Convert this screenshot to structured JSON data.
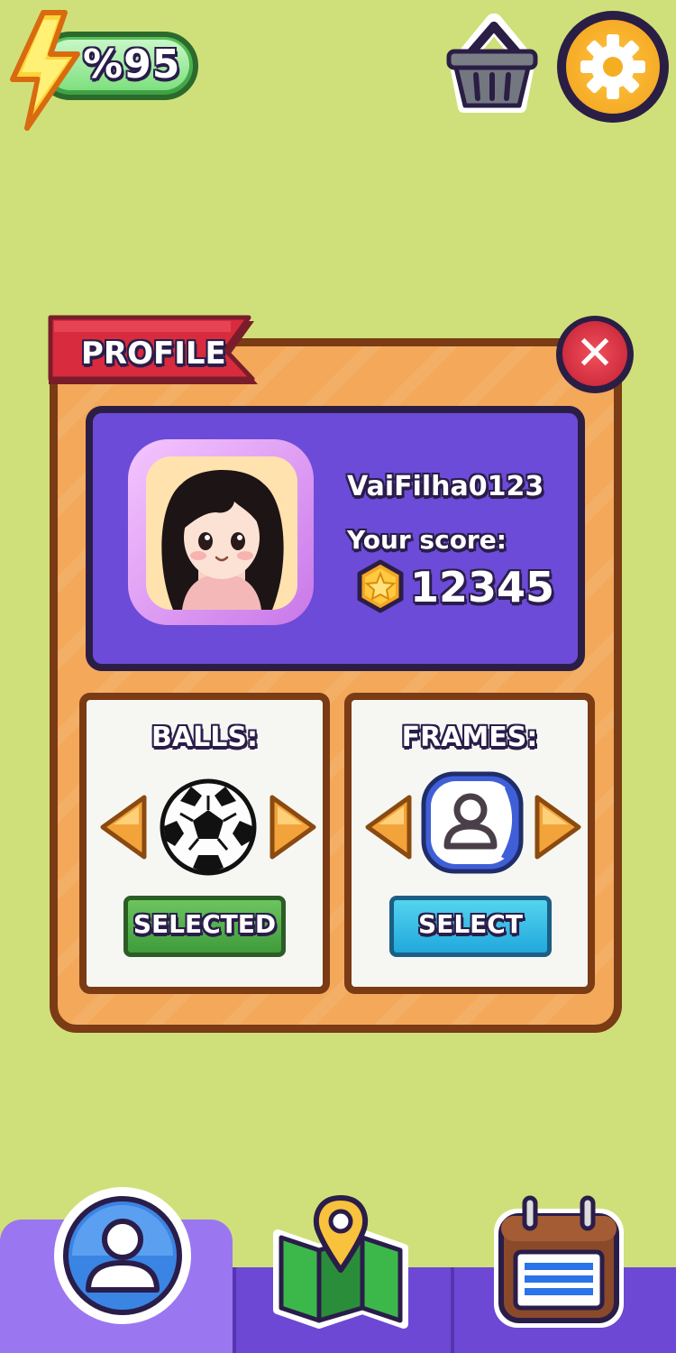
{
  "hud": {
    "energy": "%95",
    "energy_level": 0.95,
    "shop_icon": "basket-icon",
    "settings_icon": "gear-icon"
  },
  "profile": {
    "title": "PROFILE",
    "close_icon": "close-icon",
    "username": "VaiFilha0123",
    "score_label": "Your score:",
    "score": "12345",
    "coin_icon": "star-coin-icon"
  },
  "balls": {
    "title": "BALLS:",
    "item_icon": "soccer-ball-icon",
    "button_label": "SELECTED"
  },
  "frames": {
    "title": "FRAMES:",
    "item_icon": "user-frame-icon",
    "button_label": "SELECT"
  },
  "nav": {
    "items": [
      {
        "icon": "profile-icon",
        "active": true
      },
      {
        "icon": "map-icon",
        "active": false
      },
      {
        "icon": "calendar-icon",
        "active": false
      }
    ]
  },
  "colors": {
    "background": "#cfe07a",
    "panel": "#f3a85a",
    "card": "#6c4bd8",
    "nav": "#6d48d4",
    "selected_green": "#4aa944",
    "select_blue": "#2bb8e4",
    "close_red": "#d9293b"
  }
}
